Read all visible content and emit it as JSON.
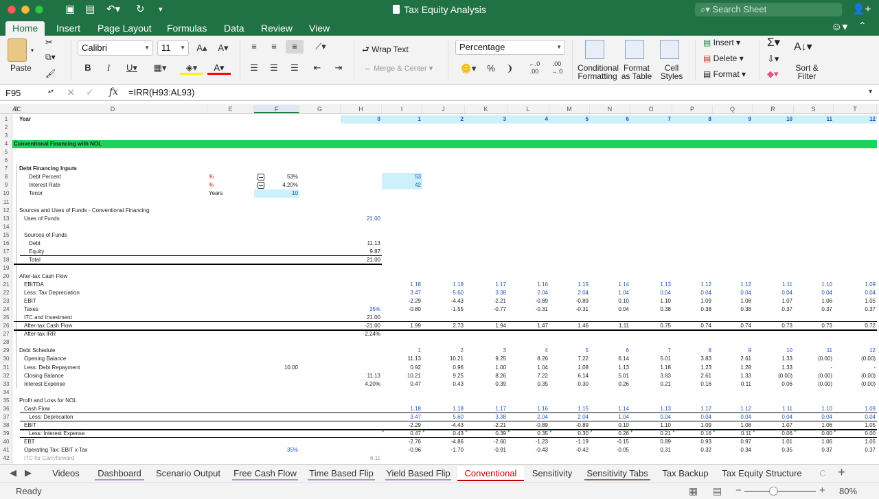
{
  "window": {
    "title": "Tax Equity Analysis",
    "search_placeholder": "Search Sheet"
  },
  "ribbon_tabs": [
    "Home",
    "Insert",
    "Page Layout",
    "Formulas",
    "Data",
    "Review",
    "View"
  ],
  "active_ribbon_tab": "Home",
  "ribbon": {
    "paste": "Paste",
    "font_name": "Calibri",
    "font_size": "11",
    "wrap_text": "Wrap Text",
    "merge_center": "Merge & Center",
    "number_format": "Percentage",
    "conditional_formatting": [
      "Conditional",
      "Formatting"
    ],
    "format_as_table": [
      "Format",
      "as Table"
    ],
    "cell_styles": [
      "Cell",
      "Styles"
    ],
    "insert": "Insert",
    "delete": "Delete",
    "format": "Format",
    "sort_filter": [
      "Sort &",
      "Filter"
    ]
  },
  "formula_bar": {
    "name_box": "F95",
    "formula": "=IRR(H93:AL93)"
  },
  "columns": [
    "A",
    "B",
    "C",
    "D",
    "E",
    "F",
    "G",
    "H",
    "I",
    "J",
    "K",
    "L",
    "M",
    "N",
    "O",
    "P",
    "Q",
    "R",
    "S",
    "T"
  ],
  "rows": [
    "1",
    "2",
    "3",
    "4",
    "5",
    "6",
    "7",
    "8",
    "9",
    "10",
    "11",
    "12",
    "13",
    "14",
    "15",
    "16",
    "17",
    "18",
    "19",
    "20",
    "21",
    "22",
    "23",
    "24",
    "25",
    "26",
    "27",
    "28",
    "29",
    "30",
    "31",
    "32",
    "33",
    "34",
    "35",
    "36",
    "37",
    "38",
    "39",
    "40",
    "41",
    "42"
  ],
  "cells": {
    "year_label": "Year",
    "years": [
      "0",
      "1",
      "2",
      "3",
      "4",
      "5",
      "6",
      "7",
      "8",
      "9",
      "10",
      "11",
      "12"
    ],
    "section_title": "Conventional Financing with NOL",
    "debt_inputs": {
      "title": "Debt Financing Inputs",
      "rows": [
        {
          "label": "Debt Percent",
          "unit": "%",
          "value": "53%",
          "aux": "53"
        },
        {
          "label": "Interest Rate",
          "unit": "%",
          "value": "4.20%",
          "aux": "42"
        },
        {
          "label": "Tenor",
          "unit": "Years",
          "value": "10",
          "aux": ""
        }
      ]
    },
    "sources_uses_title": "Sources and Uses of Funds - Conventional Financing",
    "uses_label": "Uses of Funds",
    "uses_value": "21.00",
    "sources_label": "Sources of Funds",
    "sources": [
      {
        "label": "Debt",
        "value": "11.13"
      },
      {
        "label": "Equity",
        "value": "9.87"
      },
      {
        "label": "Total",
        "value": "21.00"
      }
    ],
    "cash_flow": {
      "title": "After-tax Cash Flow",
      "rows": [
        {
          "label": "EBITDA",
          "h": "",
          "values": [
            "1.18",
            "1.18",
            "1.17",
            "1.16",
            "1.15",
            "1.14",
            "1.13",
            "1.12",
            "1.12",
            "1.11",
            "1.10",
            "1.09"
          ]
        },
        {
          "label": "Less: Tax Depreciation",
          "h": "",
          "values": [
            "3.47",
            "5.60",
            "3.38",
            "2.04",
            "2.04",
            "1.04",
            "0.04",
            "0.04",
            "0.04",
            "0.04",
            "0.04",
            "0.04"
          ]
        },
        {
          "label": "EBIT",
          "h": "",
          "values": [
            "-2.29",
            "-4.43",
            "-2.21",
            "-0.89",
            "-0.89",
            "0.10",
            "1.10",
            "1.09",
            "1.08",
            "1.07",
            "1.06",
            "1.05"
          ]
        },
        {
          "label": "Taxes",
          "h": "35%",
          "values": [
            "-0.80",
            "-1.55",
            "-0.77",
            "-0.31",
            "-0.31",
            "0.04",
            "0.38",
            "0.38",
            "0.38",
            "0.37",
            "0.37",
            "0.37"
          ]
        },
        {
          "label": "ITC and Investment",
          "h": "21.00",
          "values": []
        },
        {
          "label": "After-tax Cash Flow",
          "h": "-21.00",
          "values": [
            "1.99",
            "2.73",
            "1.94",
            "1.47",
            "1.46",
            "1.11",
            "0.75",
            "0.74",
            "0.74",
            "0.73",
            "0.73",
            "0.72"
          ]
        },
        {
          "label": "After-tax IRR",
          "h": "2.24%",
          "values": []
        }
      ]
    },
    "debt_schedule": {
      "title": "Debt Schedule",
      "period": [
        "1",
        "2",
        "3",
        "4",
        "5",
        "6",
        "7",
        "8",
        "9",
        "10",
        "11",
        "12"
      ],
      "rows": [
        {
          "label": "Opening Balance",
          "f": "",
          "h": "",
          "values": [
            "11.13",
            "10.21",
            "9.25",
            "8.26",
            "7.22",
            "6.14",
            "5.01",
            "3.83",
            "2.61",
            "1.33",
            "(0.00)",
            "(0.00)"
          ]
        },
        {
          "label": "Less: Debt Repayment",
          "f": "10.00",
          "h": "",
          "values": [
            "0.92",
            "0.96",
            "1.00",
            "1.04",
            "1.08",
            "1.13",
            "1.18",
            "1.23",
            "1.28",
            "1.33",
            "-",
            "-"
          ]
        },
        {
          "label": "Closing Balance",
          "f": "",
          "h": "11.13",
          "values": [
            "10.21",
            "9.25",
            "8.26",
            "7.22",
            "6.14",
            "5.01",
            "3.83",
            "2.61",
            "1.33",
            "(0.00)",
            "(0.00)",
            "(0.00)"
          ]
        },
        {
          "label": "Interest Expense",
          "f": "",
          "h": "4.20%",
          "values": [
            "0.47",
            "0.43",
            "0.39",
            "0.35",
            "0.30",
            "0.26",
            "0.21",
            "0.16",
            "0.11",
            "0.06",
            "(0.00)",
            "(0.00)"
          ]
        }
      ]
    },
    "pnl": {
      "title": "Profit and Loss for NOL",
      "rows": [
        {
          "label": "Cash Flow",
          "values": [
            "1.18",
            "1.18",
            "1.17",
            "1.16",
            "1.15",
            "1.14",
            "1.13",
            "1.12",
            "1.12",
            "1.11",
            "1.10",
            "1.09"
          ]
        },
        {
          "label": "Less: Deprecaiton",
          "values": [
            "3.47",
            "5.60",
            "3.38",
            "2.04",
            "2.04",
            "1.04",
            "0.04",
            "0.04",
            "0.04",
            "0.04",
            "0.04",
            "0.04"
          ]
        },
        {
          "label": "EBIT",
          "values": [
            "-2.29",
            "-4.43",
            "-2.21",
            "-0.89",
            "-0.89",
            "0.10",
            "1.10",
            "1.09",
            "1.08",
            "1.07",
            "1.06",
            "1.05"
          ]
        },
        {
          "label": "Less: Interest Expense",
          "values": [
            "0.47",
            "0.43",
            "0.39",
            "0.35",
            "0.30",
            "0.26",
            "0.21",
            "0.16",
            "0.11",
            "0.06",
            "0.00",
            "0.00"
          ]
        },
        {
          "label": "EBT",
          "values": [
            "-2.76",
            "-4.86",
            "-2.60",
            "-1.23",
            "-1.19",
            "-0.15",
            "0.89",
            "0.93",
            "0.97",
            "1.01",
            "1.06",
            "1.05"
          ]
        },
        {
          "label": "Operating Tax: EBIT x Tax",
          "f": "35%",
          "values": [
            "-0.96",
            "-1.70",
            "-0.91",
            "-0.43",
            "-0.42",
            "-0.05",
            "0.31",
            "0.32",
            "0.34",
            "0.35",
            "0.37",
            "0.37"
          ]
        },
        {
          "label": "ITC for Carryforward",
          "h": "6.11",
          "values": []
        }
      ]
    }
  },
  "sheet_tabs": [
    {
      "label": "Videos",
      "color": ""
    },
    {
      "label": "Dashboard",
      "color": "#b18fd0"
    },
    {
      "label": "Scenario Output",
      "color": ""
    },
    {
      "label": "Free Cash Flow",
      "color": "#b18fd0"
    },
    {
      "label": "Time Based Flip",
      "color": "#b18fd0"
    },
    {
      "label": "Yield Based Flip",
      "color": "#b18fd0"
    },
    {
      "label": "Conventional",
      "color": "#c00000"
    },
    {
      "label": "Sensitivity",
      "color": ""
    },
    {
      "label": "Sensitivity Tabs",
      "color": "#8a6d57"
    },
    {
      "label": "Tax Backup",
      "color": ""
    },
    {
      "label": "Tax Equity Structure",
      "color": ""
    },
    {
      "label": "C",
      "color": ""
    }
  ],
  "active_sheet": "Conventional",
  "status": {
    "text": "Ready",
    "zoom": "80%"
  }
}
